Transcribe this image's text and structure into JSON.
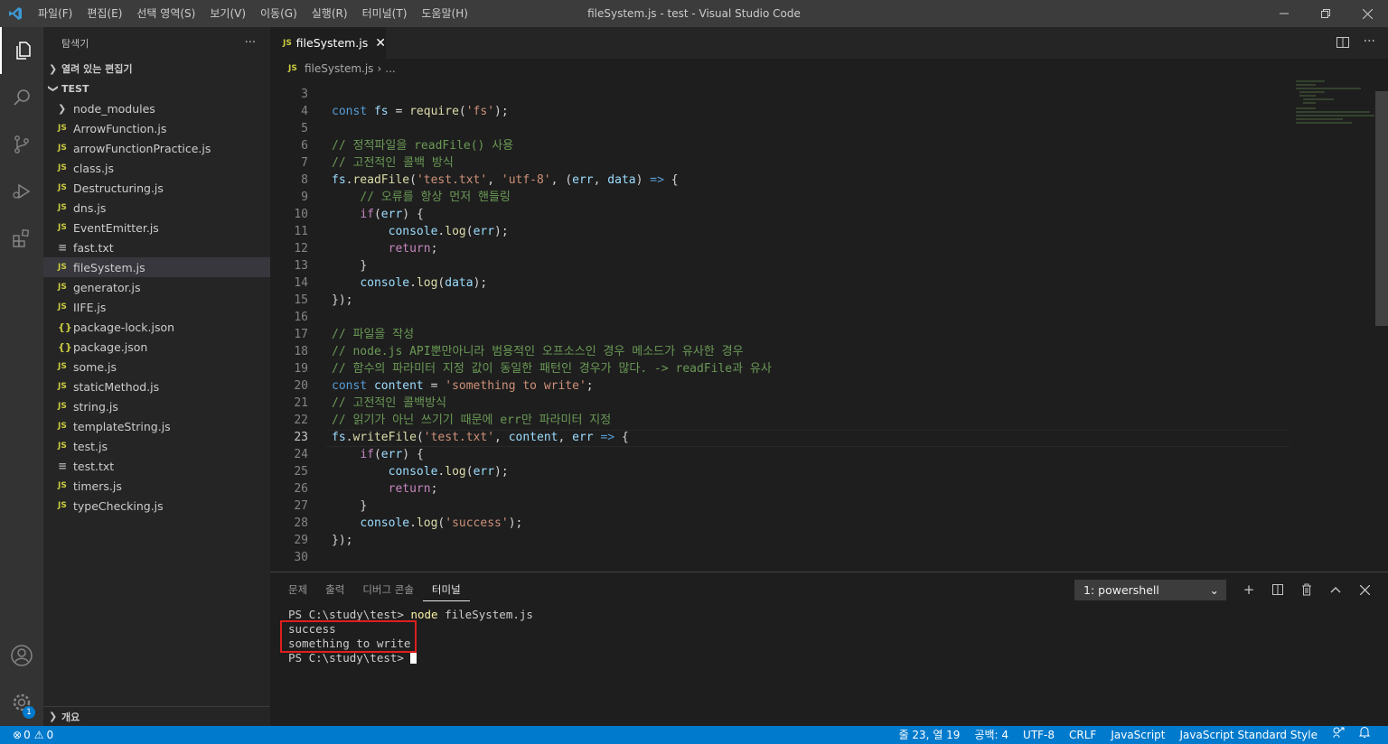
{
  "titlebar": {
    "title": "fileSystem.js - test - Visual Studio Code",
    "menu": [
      "파일(F)",
      "편집(E)",
      "선택 영역(S)",
      "보기(V)",
      "이동(G)",
      "실행(R)",
      "터미널(T)",
      "도움말(H)"
    ]
  },
  "sidebar": {
    "header": "탐색기",
    "more": "···",
    "open_editors": "열려 있는 편집기",
    "folder": "TEST",
    "items": [
      {
        "label": "node_modules",
        "icon": "folder"
      },
      {
        "label": "ArrowFunction.js",
        "icon": "JS"
      },
      {
        "label": "arrowFunctionPractice.js",
        "icon": "JS"
      },
      {
        "label": "class.js",
        "icon": "JS"
      },
      {
        "label": "Destructuring.js",
        "icon": "JS"
      },
      {
        "label": "dns.js",
        "icon": "JS"
      },
      {
        "label": "EventEmitter.js",
        "icon": "JS"
      },
      {
        "label": "fast.txt",
        "icon": "txt"
      },
      {
        "label": "fileSystem.js",
        "icon": "JS"
      },
      {
        "label": "generator.js",
        "icon": "JS"
      },
      {
        "label": "IIFE.js",
        "icon": "JS"
      },
      {
        "label": "package-lock.json",
        "icon": "{}"
      },
      {
        "label": "package.json",
        "icon": "{}"
      },
      {
        "label": "some.js",
        "icon": "JS"
      },
      {
        "label": "staticMethod.js",
        "icon": "JS"
      },
      {
        "label": "string.js",
        "icon": "JS"
      },
      {
        "label": "templateString.js",
        "icon": "JS"
      },
      {
        "label": "test.js",
        "icon": "JS"
      },
      {
        "label": "test.txt",
        "icon": "txt"
      },
      {
        "label": "timers.js",
        "icon": "JS"
      },
      {
        "label": "typeChecking.js",
        "icon": "JS"
      }
    ],
    "selected_item": "fileSystem.js",
    "outline": "개요"
  },
  "editor": {
    "tab_label": "fileSystem.js",
    "tab_icon": "JS",
    "breadcrumb_file": "fileSystem.js",
    "breadcrumb_more": "...",
    "line_numbers": [
      "3",
      "4",
      "5",
      "6",
      "7",
      "8",
      "9",
      "10",
      "11",
      "12",
      "13",
      "14",
      "15",
      "16",
      "17",
      "18",
      "19",
      "20",
      "21",
      "22",
      "23",
      "24",
      "25",
      "26",
      "27",
      "28",
      "29",
      "30"
    ],
    "cursor_line": "23",
    "code_lines": [
      "",
      "const fs = require('fs');",
      "",
      "// 정적파일을 readFile() 사용",
      "// 고전적인 콜백 방식",
      "fs.readFile('test.txt', 'utf-8', (err, data) => {",
      "    // 오류를 항상 먼저 핸들링",
      "    if(err) {",
      "        console.log(err);",
      "        return;",
      "    }",
      "    console.log(data);",
      "});",
      "",
      "// 파일을 작성",
      "// node.js API뿐만아니라 범용적인 오프소스인 경우 메소드가 유사한 경우",
      "// 함수의 파라미터 지정 값이 동일한 패턴인 경우가 많다. -> readFile과 유사",
      "const content = 'something to write';",
      "// 고전적인 콜백방식",
      "// 읽기가 아닌 쓰기기 때문에 err만 파라미터 지정",
      "fs.writeFile('test.txt', content, err => {",
      "    if(err) {",
      "        console.log(err);",
      "        return;",
      "    }",
      "    console.log('success');",
      "});",
      ""
    ]
  },
  "panel": {
    "tabs": [
      "문제",
      "출력",
      "디버그 콘솔",
      "터미널"
    ],
    "active_tab": "터미널",
    "terminal_select": "1: powershell",
    "terminal_lines": [
      "PS C:\\study\\test> node fileSystem.js",
      "success",
      "something to write",
      "PS C:\\study\\test> "
    ]
  },
  "statusbar": {
    "errors": "0",
    "warnings": "0",
    "position": "줄 23, 열 19",
    "indent": "공백: 4",
    "encoding": "UTF-8",
    "eol": "CRLF",
    "language": "JavaScript",
    "linter": "JavaScript Standard Style"
  },
  "colors": {
    "accent": "#007acc",
    "editor_bg": "#1e1e1e",
    "sidebar_bg": "#252526",
    "activity_bg": "#333333",
    "highlight_box": "#e01e1e"
  }
}
